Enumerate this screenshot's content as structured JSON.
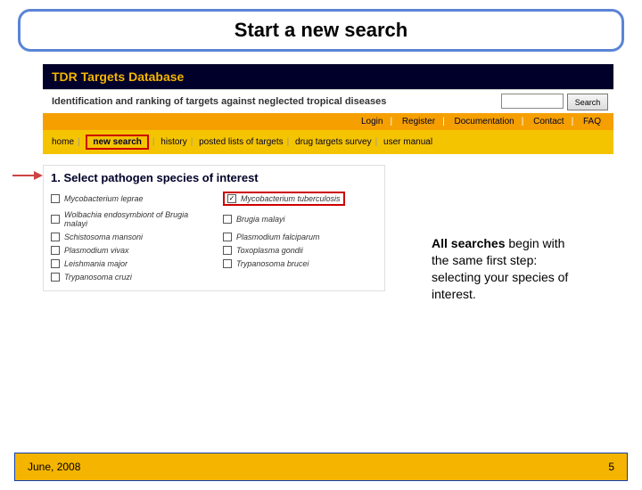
{
  "slide": {
    "title": "Start a new search"
  },
  "header": {
    "title": "TDR Targets Database",
    "subtitle": "Identification and ranking of targets against neglected tropical diseases",
    "search_button": "Search"
  },
  "topnav": {
    "login": "Login",
    "register": "Register",
    "documentation": "Documentation",
    "contact": "Contact",
    "faq": "FAQ"
  },
  "nav": {
    "home": "home",
    "new_search": "new search",
    "history": "history",
    "posted_lists": "posted lists of targets",
    "survey": "drug targets survey",
    "manual": "user manual"
  },
  "panel": {
    "title": "1. Select pathogen species of interest",
    "species": {
      "leprae": "Mycobacterium leprae",
      "tuberculosis": "Mycobacterium tuberculosis",
      "wolbachia": "Wolbachia endosymbiont of Brugia malayi",
      "brugia": "Brugia malayi",
      "schisto": "Schistosoma mansoni",
      "pfalc": "Plasmodium falciparum",
      "pvivax": "Plasmodium vivax",
      "toxo": "Toxoplasma gondii",
      "leish": "Leishmania major",
      "tbrucei": "Trypanosoma brucei",
      "tcruzi": "Trypanosoma cruzi"
    }
  },
  "explain": {
    "bold": "All searches",
    "rest": " begin with the same first step: selecting your species of interest."
  },
  "footer": {
    "date": "June, 2008",
    "page": "5"
  }
}
